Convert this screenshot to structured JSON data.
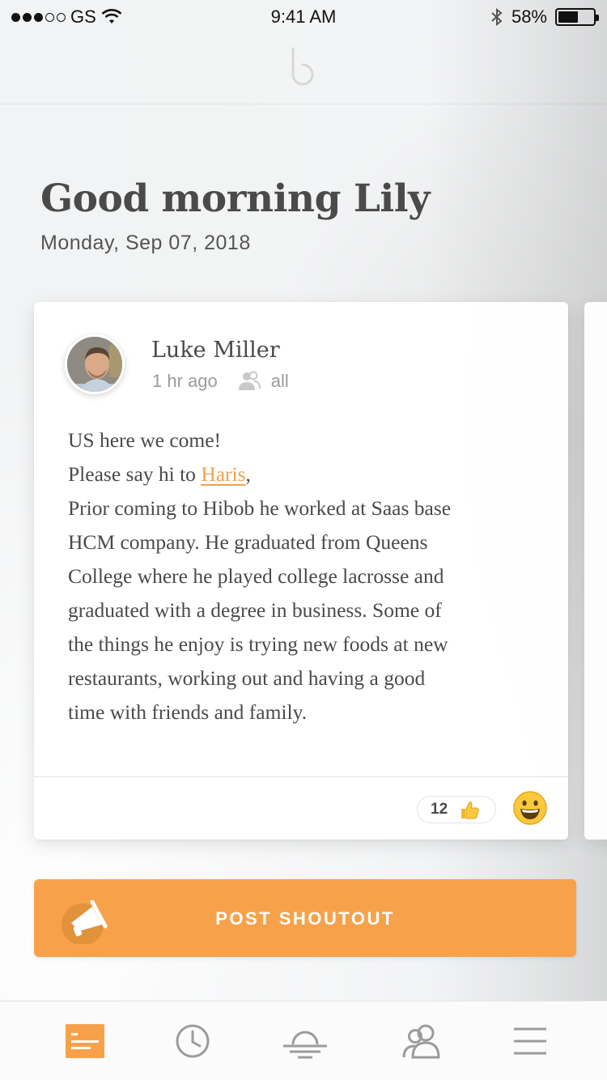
{
  "status_bar": {
    "carrier": "GS",
    "time": "9:41 AM",
    "battery": "58%",
    "battery_level": 0.58,
    "signal_bars_filled": 3,
    "signal_bars_total": 5
  },
  "header": {
    "greeting": "Good morning Lily",
    "date": "Monday, Sep 07, 2018"
  },
  "post": {
    "author": "Luke Miller",
    "time_ago": "1 hr ago",
    "audience": "all",
    "audience_icon": "people-icon",
    "body": {
      "line1": "US here we come!",
      "line2_prefix": "Please say hi to ",
      "mention": "Haris",
      "line2_suffix": ",",
      "lines": [
        "Prior coming to Hibob he worked at Saas base",
        "HCM company. He graduated from Queens",
        "College where he played college lacrosse and",
        "graduated with a degree in business. Some of",
        "the things he enjoy is trying new foods at new",
        "restaurants, working out and having a good",
        "time with friends and family."
      ]
    },
    "like_count": "12",
    "like_icon": "thumbs-up-icon",
    "reaction_icon": "smiley-icon"
  },
  "shoutout_button": {
    "label": "POST SHOUTOUT",
    "icon": "megaphone-icon"
  },
  "tab_bar": {
    "tabs": [
      {
        "icon": "feed-icon",
        "active": true
      },
      {
        "icon": "clock-icon",
        "active": false
      },
      {
        "icon": "desk-icon",
        "active": false
      },
      {
        "icon": "people-icon",
        "active": false
      },
      {
        "icon": "menu-icon",
        "active": false
      }
    ]
  },
  "colors": {
    "accent": "#f7a24a",
    "text": "#4a4a4a",
    "muted": "#9b9b9b"
  }
}
